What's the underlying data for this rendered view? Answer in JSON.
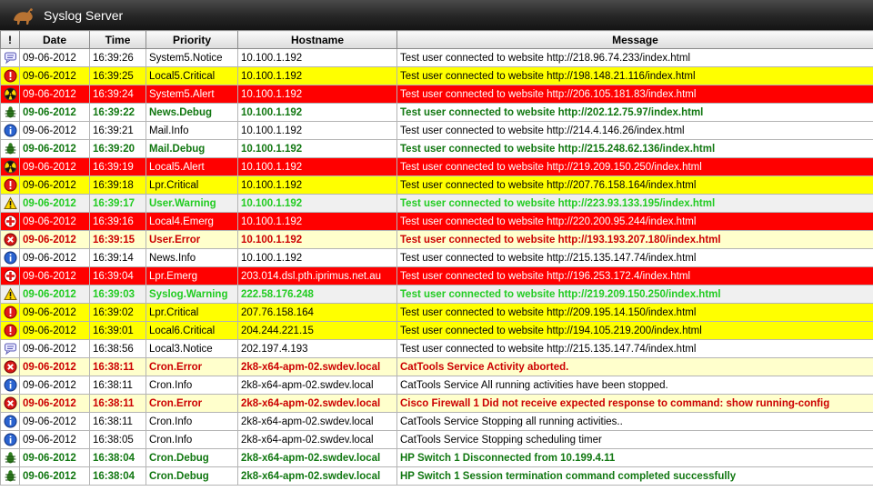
{
  "app": {
    "title": "Syslog Server"
  },
  "columns": {
    "icon": "!",
    "date": "Date",
    "time": "Time",
    "priority": "Priority",
    "hostname": "Hostname",
    "message": "Message"
  },
  "colors": {
    "critical_bg": "#ffff00",
    "alert_bg": "#ff0000",
    "error_text": "#cc0000",
    "warning_text": "#22cc22",
    "debug_text": "#117711"
  },
  "rows": [
    {
      "icon": "notice-icon",
      "style": "w",
      "date": "09-06-2012",
      "time": "16:39:26",
      "priority": "System5.Notice",
      "hostname": "10.100.1.192",
      "message": "Test user connected to website http://218.96.74.233/index.html"
    },
    {
      "icon": "critical-icon",
      "style": "crit",
      "date": "09-06-2012",
      "time": "16:39:25",
      "priority": "Local5.Critical",
      "hostname": "10.100.1.192",
      "message": "Test user connected to website http://198.148.21.116/index.html"
    },
    {
      "icon": "alert-icon",
      "style": "alert",
      "date": "09-06-2012",
      "time": "16:39:24",
      "priority": "System5.Alert",
      "hostname": "10.100.1.192",
      "message": "Test user connected to website http://206.105.181.83/index.html"
    },
    {
      "icon": "debug-icon",
      "style": "dbg",
      "date": "09-06-2012",
      "time": "16:39:22",
      "priority": "News.Debug",
      "hostname": "10.100.1.192",
      "message": "Test user connected to website http://202.12.75.97/index.html"
    },
    {
      "icon": "info-icon",
      "style": "w",
      "date": "09-06-2012",
      "time": "16:39:21",
      "priority": "Mail.Info",
      "hostname": "10.100.1.192",
      "message": "Test user connected to website http://214.4.146.26/index.html"
    },
    {
      "icon": "debug-icon",
      "style": "dbg",
      "date": "09-06-2012",
      "time": "16:39:20",
      "priority": "Mail.Debug",
      "hostname": "10.100.1.192",
      "message": "Test user connected to website http://215.248.62.136/index.html"
    },
    {
      "icon": "alert-icon",
      "style": "alert",
      "date": "09-06-2012",
      "time": "16:39:19",
      "priority": "Local5.Alert",
      "hostname": "10.100.1.192",
      "message": "Test user connected to website http://219.209.150.250/index.html"
    },
    {
      "icon": "critical-icon",
      "style": "crit",
      "date": "09-06-2012",
      "time": "16:39:18",
      "priority": "Lpr.Critical",
      "hostname": "10.100.1.192",
      "message": "Test user connected to website http://207.76.158.164/index.html"
    },
    {
      "icon": "warning-icon",
      "style": "warn",
      "date": "09-06-2012",
      "time": "16:39:17",
      "priority": "User.Warning",
      "hostname": "10.100.1.192",
      "message": "Test user connected to website http://223.93.133.195/index.html"
    },
    {
      "icon": "emergency-icon",
      "style": "alert",
      "date": "09-06-2012",
      "time": "16:39:16",
      "priority": "Local4.Emerg",
      "hostname": "10.100.1.192",
      "message": "Test user connected to website http://220.200.95.244/index.html"
    },
    {
      "icon": "error-icon",
      "style": "err",
      "date": "09-06-2012",
      "time": "16:39:15",
      "priority": "User.Error",
      "hostname": "10.100.1.192",
      "message": "Test user connected to website http://193.193.207.180/index.html"
    },
    {
      "icon": "info-icon",
      "style": "w",
      "date": "09-06-2012",
      "time": "16:39:14",
      "priority": "News.Info",
      "hostname": "10.100.1.192",
      "message": "Test user connected to website http://215.135.147.74/index.html"
    },
    {
      "icon": "emergency-icon",
      "style": "alert",
      "date": "09-06-2012",
      "time": "16:39:04",
      "priority": "Lpr.Emerg",
      "hostname": "203.014.dsl.pth.iprimus.net.au",
      "message": "Test user connected to website http://196.253.172.4/index.html"
    },
    {
      "icon": "warning-icon",
      "style": "warn",
      "date": "09-06-2012",
      "time": "16:39:03",
      "priority": "Syslog.Warning",
      "hostname": "222.58.176.248",
      "message": "Test user connected to website http://219.209.150.250/index.html"
    },
    {
      "icon": "critical-icon",
      "style": "crit",
      "date": "09-06-2012",
      "time": "16:39:02",
      "priority": "Lpr.Critical",
      "hostname": "207.76.158.164",
      "message": "Test user connected to website http://209.195.14.150/index.html"
    },
    {
      "icon": "critical-icon",
      "style": "crit",
      "date": "09-06-2012",
      "time": "16:39:01",
      "priority": "Local6.Critical",
      "hostname": "204.244.221.15",
      "message": "Test user connected to website http://194.105.219.200/index.html"
    },
    {
      "icon": "notice-icon",
      "style": "w",
      "date": "09-06-2012",
      "time": "16:38:56",
      "priority": "Local3.Notice",
      "hostname": "202.197.4.193",
      "message": "Test user connected to website http://215.135.147.74/index.html"
    },
    {
      "icon": "error-icon",
      "style": "err",
      "date": "09-06-2012",
      "time": "16:38:11",
      "priority": "Cron.Error",
      "hostname": "2k8-x64-apm-02.swdev.local",
      "message": "CatTools Service Activity aborted."
    },
    {
      "icon": "info-icon",
      "style": "w",
      "date": "09-06-2012",
      "time": "16:38:11",
      "priority": "Cron.Info",
      "hostname": "2k8-x64-apm-02.swdev.local",
      "message": "CatTools Service All running activities have been stopped."
    },
    {
      "icon": "error-icon",
      "style": "err",
      "date": "09-06-2012",
      "time": "16:38:11",
      "priority": "Cron.Error",
      "hostname": "2k8-x64-apm-02.swdev.local",
      "message": "Cisco Firewall 1 Did not receive expected response to command: show running-config"
    },
    {
      "icon": "info-icon",
      "style": "w",
      "date": "09-06-2012",
      "time": "16:38:11",
      "priority": "Cron.Info",
      "hostname": "2k8-x64-apm-02.swdev.local",
      "message": "CatTools Service Stopping all running activities.."
    },
    {
      "icon": "info-icon",
      "style": "w",
      "date": "09-06-2012",
      "time": "16:38:05",
      "priority": "Cron.Info",
      "hostname": "2k8-x64-apm-02.swdev.local",
      "message": "CatTools Service Stopping scheduling timer"
    },
    {
      "icon": "debug-icon",
      "style": "dbg",
      "date": "09-06-2012",
      "time": "16:38:04",
      "priority": "Cron.Debug",
      "hostname": "2k8-x64-apm-02.swdev.local",
      "message": "HP Switch 1 Disconnected from 10.199.4.11"
    },
    {
      "icon": "debug-icon",
      "style": "dbg",
      "date": "09-06-2012",
      "time": "16:38:04",
      "priority": "Cron.Debug",
      "hostname": "2k8-x64-apm-02.swdev.local",
      "message": "HP Switch 1 Session termination command completed successfully"
    }
  ]
}
